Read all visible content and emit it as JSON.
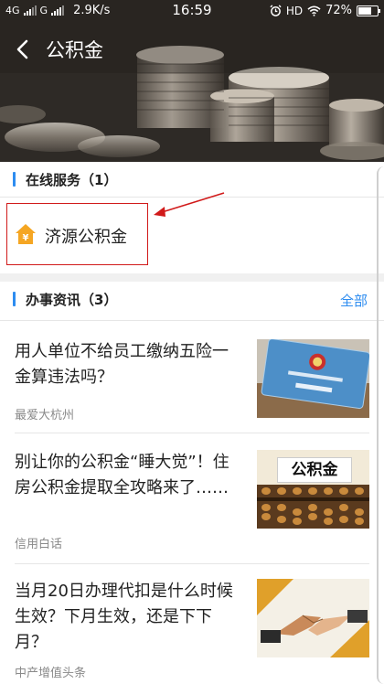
{
  "status": {
    "net1": "4G",
    "net2": "G",
    "speed": "2.9K/s",
    "time": "16:59",
    "hd": "HD",
    "battery": "72%",
    "battery_level": 0.72
  },
  "header": {
    "title": "公积金"
  },
  "services": {
    "heading": "在线服务（1）",
    "items": [
      {
        "label": "济源公积金",
        "icon": "yuan-house-icon",
        "icon_color": "#f5a623"
      }
    ]
  },
  "news": {
    "heading": "办事资讯（3）",
    "more": "全部",
    "items": [
      {
        "title": "用人单位不给员工缴纳五险一金算违法吗？",
        "source": "最爱大杭州"
      },
      {
        "title": "别让你的公积金“睡大觉”！住房公积金提取全攻略来了……",
        "source": "信用白话",
        "thumb_text": "公积金"
      },
      {
        "title": "当月20日办理代扣是什么时候生效？下月生效，还是下下月？",
        "source": "中产增值头条"
      }
    ]
  },
  "colors": {
    "accent": "#2d8cf0",
    "annotation": "#d11a1a"
  }
}
